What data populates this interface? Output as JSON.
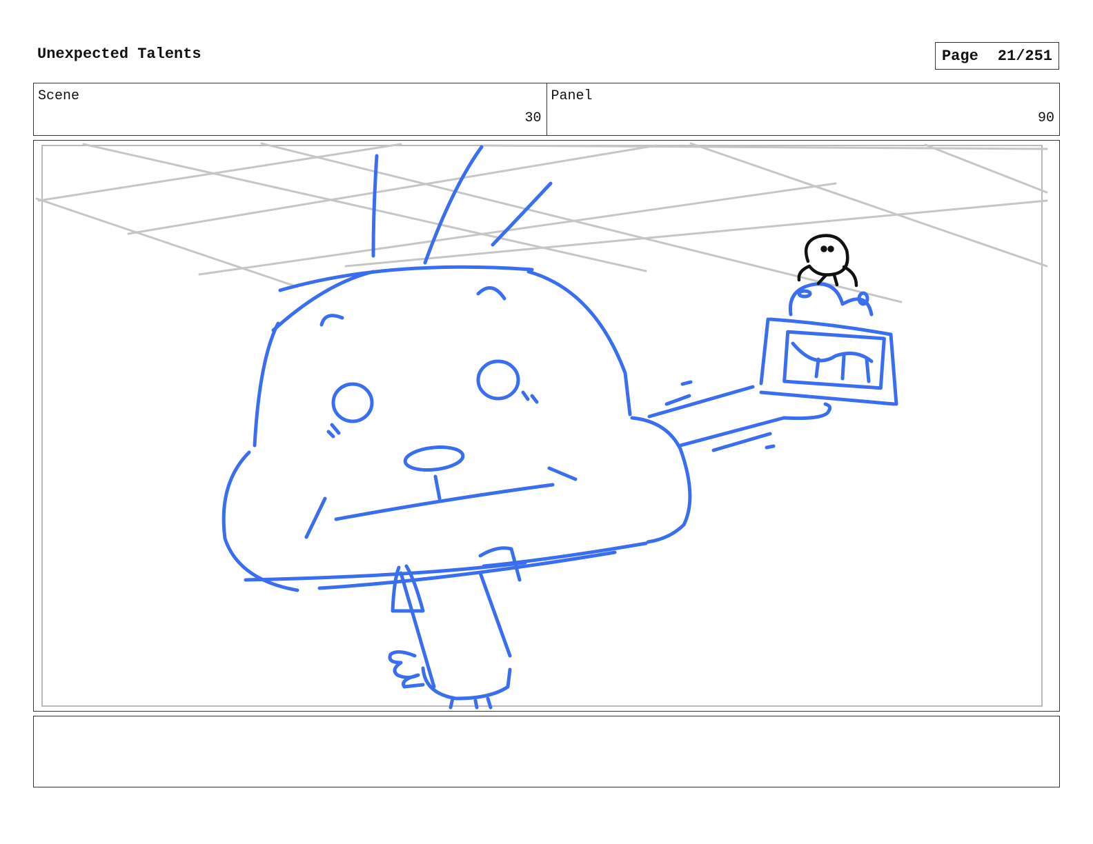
{
  "header": {
    "title": "Unexpected Talents",
    "page_label": "Page",
    "page_number": "21/251"
  },
  "info": {
    "scene_label": "Scene",
    "scene_value": "30",
    "panel_label": "Panel",
    "panel_value": "90"
  },
  "panel": {
    "stroke_color": "#3a6ef0",
    "grid_color": "#c6c6c6",
    "ink_color": "#111111"
  },
  "notes": {
    "text": ""
  }
}
